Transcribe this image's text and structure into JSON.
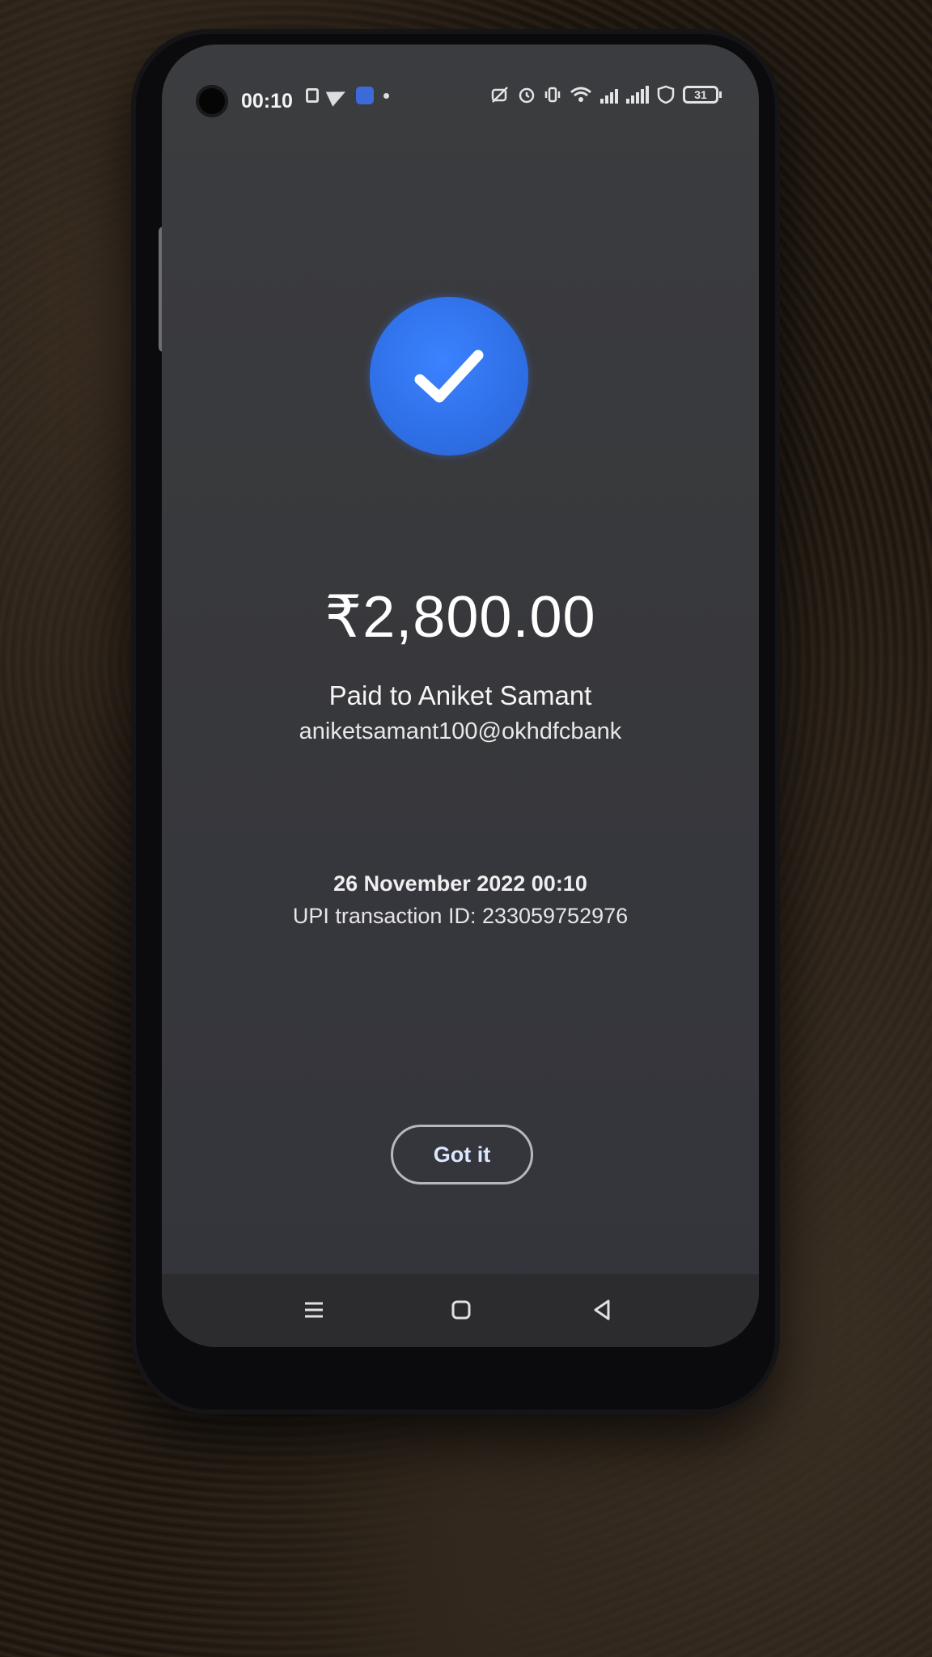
{
  "status_bar": {
    "time": "00:10",
    "battery": "31",
    "icons_left": [
      "note-icon",
      "telegram-icon",
      "app-icon",
      "dot-icon"
    ],
    "icons_right": [
      "hd-icon",
      "alarm-icon",
      "vibrate-icon",
      "wifi-icon",
      "signal-icon",
      "signal-icon",
      "vpn-shield-icon",
      "battery-icon"
    ]
  },
  "payment": {
    "amount": "₹2,800.00",
    "paid_to": "Paid to Aniket Samant",
    "upi_id": "aniketsamant100@okhdfcbank",
    "datetime": "26 November 2022 00:10",
    "transaction": "UPI transaction ID: 233059752976"
  },
  "actions": {
    "got_it_label": "Got it"
  },
  "nav": {
    "items": [
      "menu-icon",
      "home-icon",
      "back-icon"
    ]
  },
  "colors": {
    "accent": "#2f6fe6",
    "screen_bg": "#38393c",
    "nav_bg": "#2c2c2f"
  }
}
